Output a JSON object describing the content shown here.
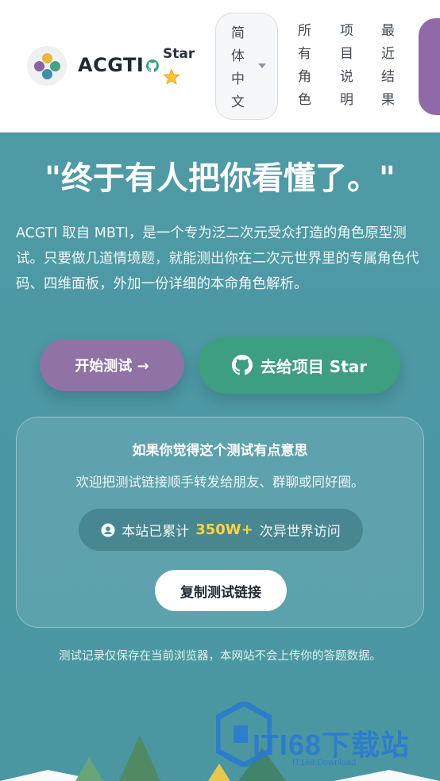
{
  "header": {
    "brand": "ACGTI",
    "star_label": "Star",
    "language": "简体中文",
    "nav": [
      "所有角色",
      "项目说明",
      "最近结果"
    ]
  },
  "hero": {
    "headline": "\"终于有人把你看懂了。\"",
    "intro": "ACGTI 取自 MBTI，是一个专为泛二次元受众打造的角色原型测试。只要做几道情境题，就能测出你在二次元世界里的专属角色代码、四维面板，外加一份详细的本命角色解析。",
    "start_button": "开始测试 →",
    "star_button": "去给项目 Star"
  },
  "share": {
    "title": "如果你觉得这个测试有点意思",
    "subtitle": "欢迎把测试链接顺手转发给朋友、群聊或同好圈。",
    "visits_prefix": "本站已累计",
    "visits_count": "350W+",
    "visits_suffix": "次异世界访问",
    "copy_button": "复制测试链接"
  },
  "footer_note": "测试记录仅保存在当前浏览器，本网站不会上传你的答题数据。",
  "watermark": {
    "title": "ITI68下载站",
    "sub": "IT168 Download"
  },
  "colors": {
    "background": "#4b98a4",
    "purple_accent": "#9072a5",
    "green_accent": "#3e9e80",
    "highlight": "#ffd43b"
  }
}
